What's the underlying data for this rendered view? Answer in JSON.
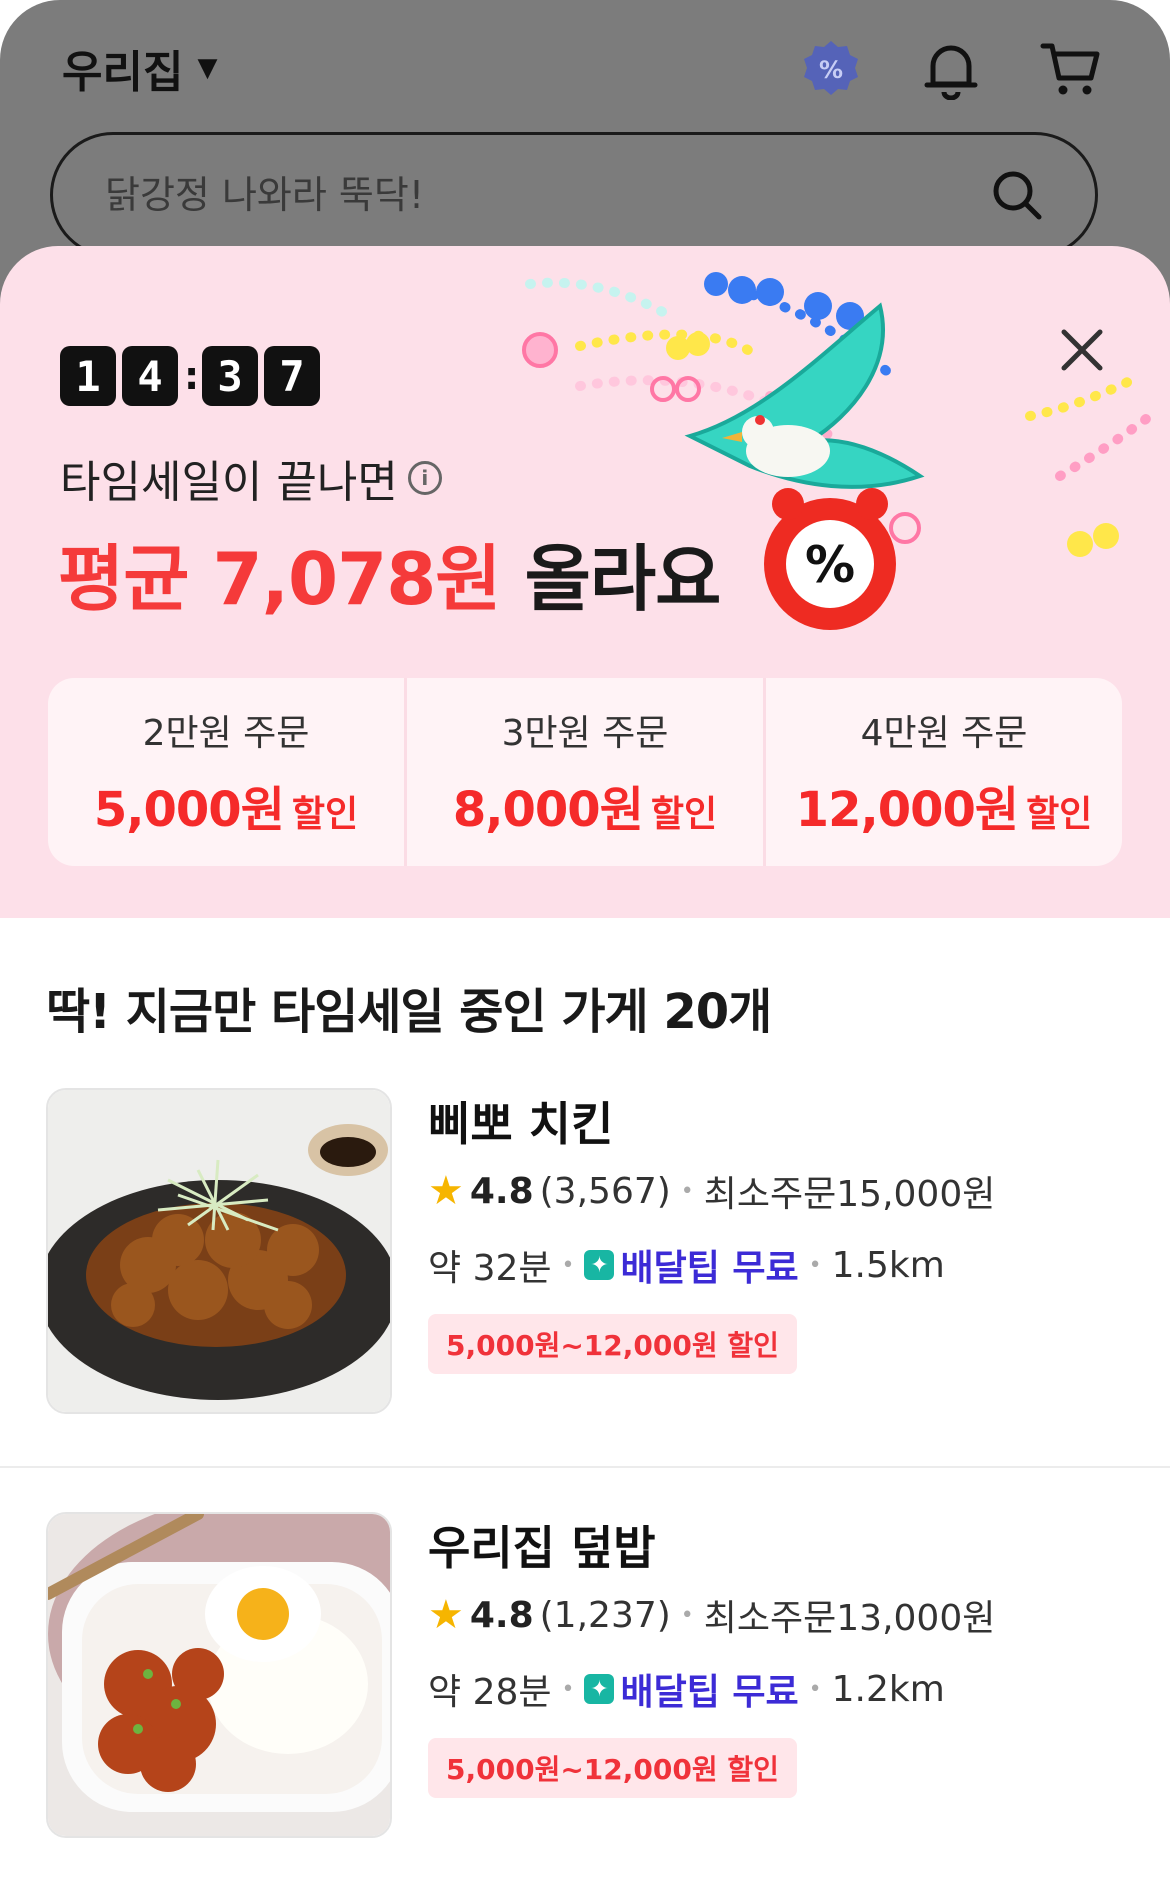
{
  "header": {
    "location": "우리집",
    "search_placeholder": "닭강정 나와라 뚝닥!"
  },
  "sale": {
    "timer": {
      "d1": "1",
      "d2": "4",
      "d3": "3",
      "d4": "7"
    },
    "subtitle": "타임세일이 끝나면",
    "headline_red": "평균 7,078원",
    "headline_black": "올라요",
    "tiers": [
      {
        "label": "2만원 주문",
        "amount": "5,000원",
        "suffix": "할인"
      },
      {
        "label": "3만원 주문",
        "amount": "8,000원",
        "suffix": "할인"
      },
      {
        "label": "4만원 주문",
        "amount": "12,000원",
        "suffix": "할인"
      }
    ]
  },
  "list": {
    "title": "딱! 지금만 타임세일 중인 가게 20개",
    "stores": [
      {
        "name": "삐뽀 치킨",
        "rating": "4.8",
        "reviews": "(3,567)",
        "min_order": "최소주문15,000원",
        "time": "약 32분",
        "delivery": "배달팁 무료",
        "distance": "1.5km",
        "discount": "5,000원~12,000원 할인"
      },
      {
        "name": "우리집 덮밥",
        "rating": "4.8",
        "reviews": "(1,237)",
        "min_order": "최소주문13,000원",
        "time": "약 28분",
        "delivery": "배달팁 무료",
        "distance": "1.2km",
        "discount": "5,000원~12,000원 할인"
      }
    ]
  },
  "colors": {
    "accent_red": "#f53a3a",
    "sheet_pink": "#fde0e9",
    "free_delivery": "#3c2bd6"
  }
}
